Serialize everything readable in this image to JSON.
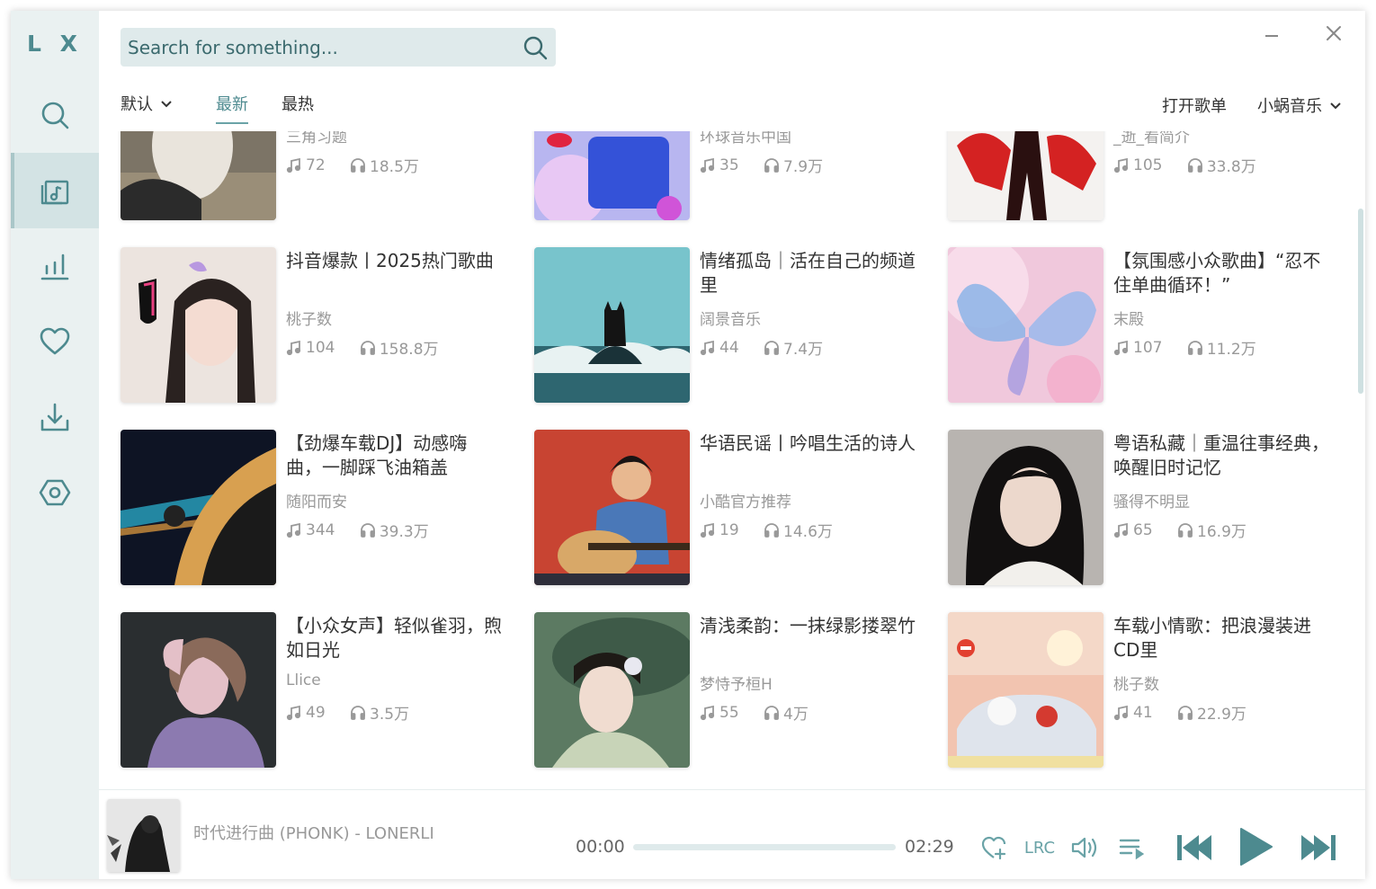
{
  "app": {
    "logo": "L X"
  },
  "search": {
    "placeholder": "Search for something..."
  },
  "tabs": {
    "sort_default": "默认",
    "newest": "最新",
    "hottest": "最热",
    "open_playlist": "打开歌单",
    "source": "小蜗音乐"
  },
  "partial_row": [
    {
      "author": "三角习题",
      "songs": "72",
      "plays": "18.5万"
    },
    {
      "author": "环球音乐中国",
      "songs": "35",
      "plays": "7.9万"
    },
    {
      "author": "_逝_看简介",
      "songs": "105",
      "plays": "33.8万"
    }
  ],
  "playlists": [
    {
      "title": "抖音爆款丨2025热门歌曲",
      "author": "桃子数",
      "songs": "104",
      "plays": "158.8万"
    },
    {
      "title": "情绪孤岛｜活在自己的频道里",
      "author": "阔景音乐",
      "songs": "44",
      "plays": "7.4万"
    },
    {
      "title": "【氛围感小众歌曲】“忍不住单曲循环！”",
      "author": "末殿",
      "songs": "107",
      "plays": "11.2万"
    },
    {
      "title": "【劲爆车载DJ】动感嗨曲，一脚踩飞油箱盖",
      "author": "随阳而安",
      "songs": "344",
      "plays": "39.3万"
    },
    {
      "title": "华语民谣丨吟唱生活的诗人",
      "author": "小酷官方推荐",
      "songs": "19",
      "plays": "14.6万"
    },
    {
      "title": "粤语私藏｜重温往事经典，唤醒旧时记忆",
      "author": "骚得不明显",
      "songs": "65",
      "plays": "16.9万"
    },
    {
      "title": "【小众女声】轻似雀羽，煦如日光",
      "author": "Llice",
      "songs": "49",
      "plays": "3.5万"
    },
    {
      "title": "清浅柔韵：一抹绿影搂翠竹",
      "author": "梦恃予桓H",
      "songs": "55",
      "plays": "4万"
    },
    {
      "title": "车载小情歌：把浪漫装进CD里",
      "author": "桃子数",
      "songs": "41",
      "plays": "22.9万"
    }
  ],
  "player": {
    "song": "时代进行曲 (PHONK) - LONERLI",
    "current_time": "00:00",
    "total_time": "02:29",
    "progress": 0,
    "lrc_label": "LRC"
  },
  "colors": {
    "accent": "#4d8a8f",
    "sidebar_bg": "#eaf1f1",
    "sidebar_active": "#d3e3e4"
  }
}
